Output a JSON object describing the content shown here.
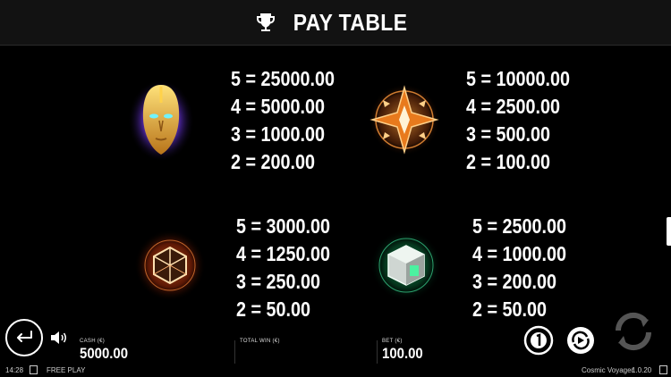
{
  "header": {
    "title": "PAY TABLE",
    "icon": "trophy-icon"
  },
  "paytable": [
    {
      "symbol": "golden-mask",
      "payouts": [
        "5 = 25000.00",
        "4 = 5000.00",
        "3 = 1000.00",
        "2 = 200.00"
      ]
    },
    {
      "symbol": "orange-star",
      "payouts": [
        "5 = 10000.00",
        "4 = 2500.00",
        "3 = 500.00",
        "2 = 100.00"
      ]
    },
    {
      "symbol": "orange-cube",
      "payouts": [
        "5 = 3000.00",
        "4 = 1250.00",
        "3 = 250.00",
        "2 = 50.00"
      ]
    },
    {
      "symbol": "green-cube",
      "payouts": [
        "5 = 2500.00",
        "4 = 1000.00",
        "3 = 200.00",
        "2 = 50.00"
      ]
    }
  ],
  "footer": {
    "cash_label": "CASH (€)",
    "cash_value": "5000.00",
    "total_win_label": "TOTAL WIN (€)",
    "total_win_value": "",
    "bet_label": "BET (€)",
    "bet_value": "100.00"
  },
  "status": {
    "time": "14:28",
    "mode": "FREE PLAY",
    "game": "Cosmic Voyager",
    "version": "1.0.20"
  },
  "colors": {
    "background": "#000000",
    "header": "#121212",
    "text": "#ffffff",
    "spin_disabled": "#555555"
  }
}
